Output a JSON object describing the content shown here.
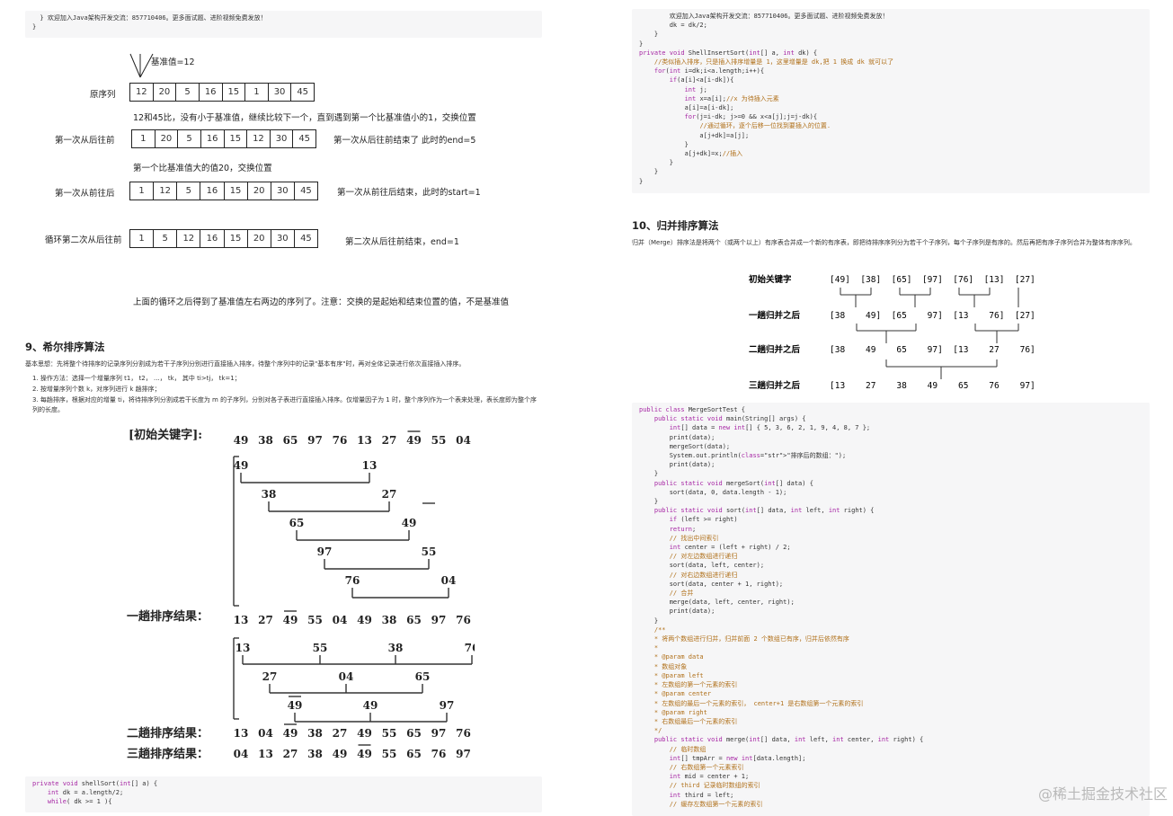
{
  "left": {
    "top_code": [
      "  } 欢迎加入Java架构开发交流：857710406。更多面试题、进阶视频免费发放！",
      "}"
    ],
    "quick_sort_diagram": {
      "pivot_label": "基准值=12",
      "rows": [
        {
          "label": "原序列",
          "values": [
            "12",
            "20",
            "5",
            "16",
            "15",
            "1",
            "30",
            "45"
          ],
          "note": ""
        },
        {
          "label": "第一次从后往前",
          "values": [
            "1",
            "20",
            "5",
            "16",
            "15",
            "12",
            "30",
            "45"
          ],
          "note": "第一次从后往前结束了    此时的end=5"
        },
        {
          "label": "第一次从前往后",
          "values": [
            "1",
            "12",
            "5",
            "16",
            "15",
            "20",
            "30",
            "45"
          ],
          "note": "第一次从前往后结束，此时的start=1"
        },
        {
          "label": "循环第二次从后往前",
          "values": [
            "1",
            "5",
            "12",
            "16",
            "15",
            "20",
            "30",
            "45"
          ],
          "note": "第二次从后往前结束，end=1"
        }
      ],
      "caption1": "12和45比，没有小于基准值，继续比较下一个，直到遇到第一个比基准值小的1，交换位置",
      "caption2": "第一个比基准值大的值20，交换位置",
      "conclusion": "上面的循环之后得到了基准值左右两边的序列了。注意：交换的是起始和结束位置的值，不是基准值"
    },
    "shell_title": "9、希尔排序算法",
    "shell_intro": "基本思想：先将整个待排序的记录序列分割成为若干子序列分别进行直接插入排序，待整个序列中的记录\"基本有序\"时，再对全体记录进行依次直接插入排序。",
    "shell_steps": [
      "1. 操作方法：选择一个增量序列 t1， t2， ...， tk， 其中 ti>tj， tk=1；",
      "2. 按增量序列个数 k，对序列进行 k 趟排序；",
      "3. 每趟排序，根据对应的增量 ti，将待排序列分割成若干长度为 m 的子序列，分别对各子表进行直接插入排序。仅增量因子为 1 时，整个序列作为一个表来处理，表长度即为整个序列的长度。"
    ],
    "shell_diagram": {
      "initial_label": "[初始关键字]:",
      "initial": [
        "49",
        "38",
        "65",
        "97",
        "76",
        "13",
        "27",
        "49",
        "55",
        "04"
      ],
      "pass1_label": "一趟排序结果：",
      "pass1": [
        "13",
        "27",
        "49",
        "55",
        "04",
        "49",
        "38",
        "65",
        "97",
        "76"
      ],
      "pass2_label": "二趟排序结果：",
      "pass2": [
        "13",
        "04",
        "49",
        "38",
        "27",
        "49",
        "55",
        "65",
        "97",
        "76"
      ],
      "pass3_label": "三趟排序结果：",
      "pass3": [
        "04",
        "13",
        "27",
        "38",
        "49",
        "49",
        "55",
        "65",
        "76",
        "97"
      ],
      "group1": [
        [
          "49",
          "13"
        ],
        [
          "38",
          "27"
        ],
        [
          "65",
          "49"
        ],
        [
          "97",
          "55"
        ],
        [
          "76",
          "04"
        ]
      ],
      "group2": [
        [
          "13",
          "55",
          "38",
          "76"
        ],
        [
          "27",
          "04",
          "65"
        ],
        [
          "49",
          "49",
          "97"
        ]
      ]
    },
    "bottom_code": [
      "private void shellSort(int[] a) {",
      "    int dk = a.length/2;",
      "    while( dk >= 1 ){"
    ]
  },
  "right": {
    "top_code": [
      "        欢迎加入Java架构开发交流：857710406。更多面试题、进阶视频免费发放！",
      "        dk = dk/2;",
      "    }",
      "}",
      "private void ShellInsertSort(int[] a, int dk) {",
      "    //类似插入排序，只是插入排序增量是 1，这里增量是 dk,把 1 换成 dk 就可以了",
      "    for(int i=dk;i<a.length;i++){",
      "        if(a[i]<a[i-dk]){",
      "            int j;",
      "            int x=a[i];//x 为待插入元素",
      "            a[i]=a[i-dk];",
      "            for(j=i-dk; j>=0 && x<a[j];j=j-dk){",
      "                //通过循环，逐个后移一位找到要插入的位置.",
      "                a[j+dk]=a[j];",
      "            }",
      "            a[j+dk]=x;//插入",
      "        }",
      "    }",
      "}"
    ],
    "merge_title": "10、归并排序算法",
    "merge_intro": "归并（Merge）排序法是将两个（或两个以上）有序表合并成一个新的有序表，即把待排序序列分为若干个子序列，每个子序列是有序的。然后再把有序子序列合并为整体有序序列。",
    "merge_diagram": {
      "rows": [
        {
          "label": "初始关键字",
          "text": "[49]  [38]  [65]  [97]  [76]  [13]  [27]"
        },
        {
          "label": "一趟归并之后",
          "text": "[38    49]  [65    97]  [13    76]  [27]"
        },
        {
          "label": "二趟归并之后",
          "text": "[38    49    65    97]  [13    27    76]"
        },
        {
          "label": "三趟归并之后",
          "text": "[13    27    38    49    65    76    97]"
        }
      ]
    },
    "merge_code": [
      "public class MergeSortTest {",
      "    public static void main(String[] args) {",
      "        int[] data = new int[] { 5, 3, 6, 2, 1, 9, 4, 8, 7 };",
      "        print(data);",
      "        mergeSort(data);",
      "        System.out.println(\"排序后的数组：\");",
      "        print(data);",
      "    }",
      "    public static void mergeSort(int[] data) {",
      "        sort(data, 0, data.length - 1);",
      "    }",
      "    public static void sort(int[] data, int left, int right) {",
      "        if (left >= right)",
      "        return;",
      "        // 找出中间索引",
      "        int center = (left + right) / 2;",
      "        // 对左边数组进行递归",
      "        sort(data, left, center);",
      "        // 对右边数组进行递归",
      "        sort(data, center + 1, right);",
      "        // 合并",
      "        merge(data, left, center, right);",
      "        print(data);",
      "    }",
      "    /**",
      "    * 将两个数组进行归并，归并前面 2 个数组已有序，归并后依然有序",
      "    *",
      "    * @param data",
      "    * 数组对象",
      "    * @param left",
      "    * 左数组的第一个元素的索引",
      "    * @param center",
      "    * 左数组的最后一个元素的索引， center+1 是右数组第一个元素的索引",
      "    * @param right",
      "    * 右数组最后一个元素的索引",
      "    */",
      "    public static void merge(int[] data, int left, int center, int right) {",
      "        // 临时数组",
      "        int[] tmpArr = new int[data.length];",
      "        // 右数组第一个元素索引",
      "        int mid = center + 1;",
      "        // third 记录临时数组的索引",
      "        int third = left;",
      "        // 缓存左数组第一个元素的索引"
    ]
  },
  "watermark": "@稀土掘金技术社区"
}
